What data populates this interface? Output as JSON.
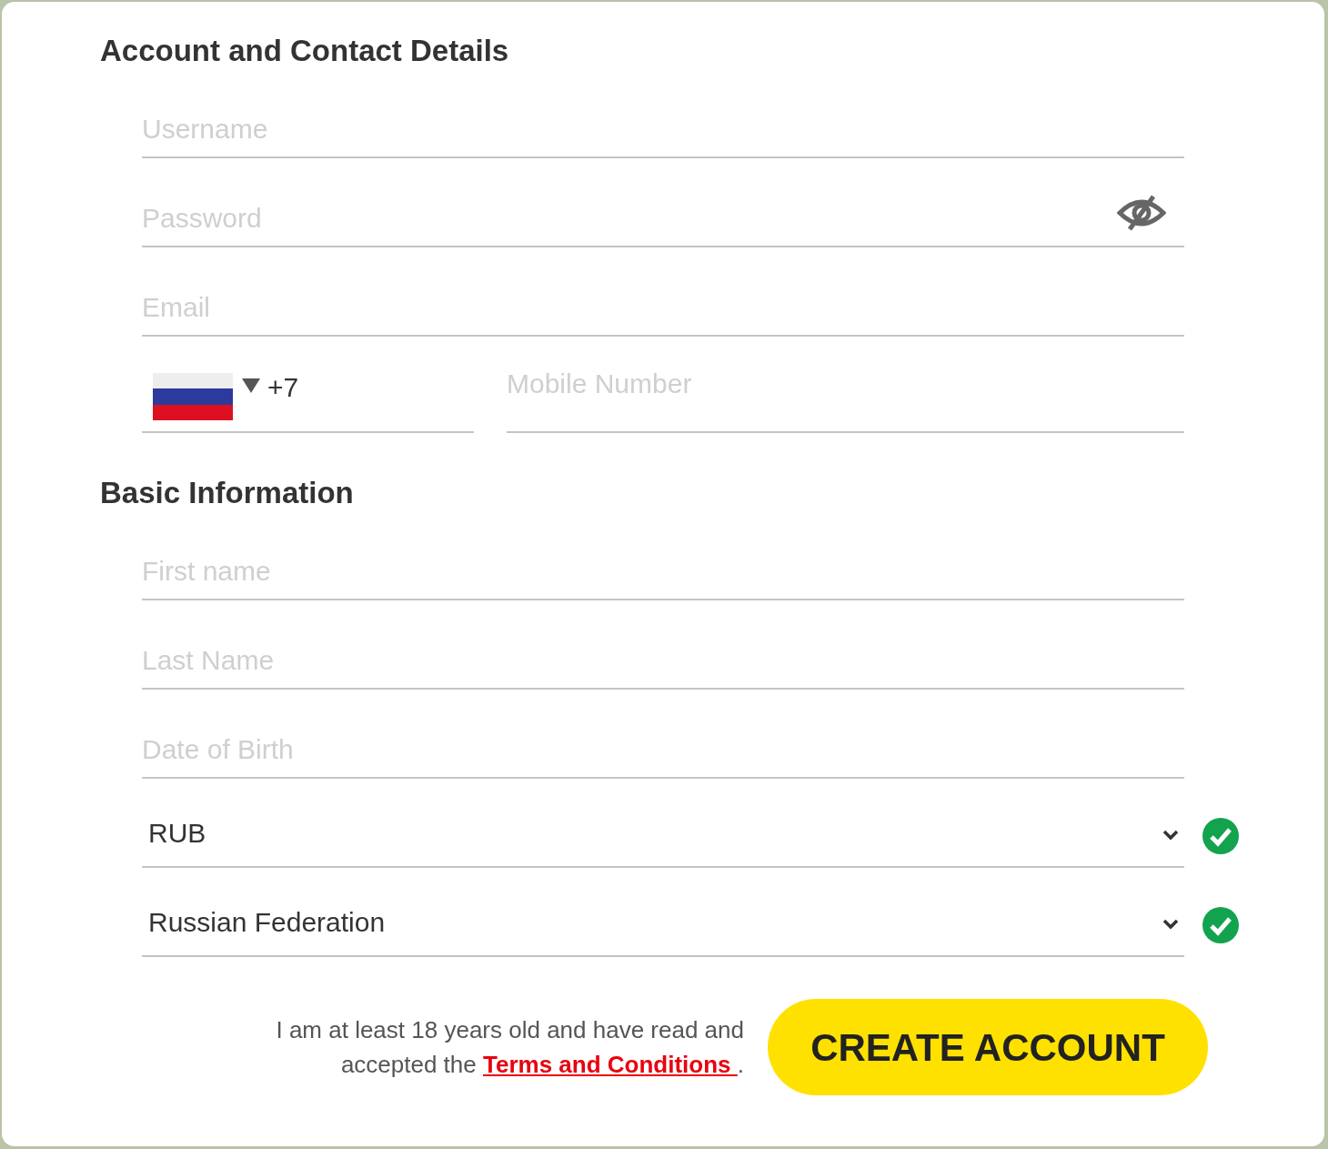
{
  "sections": [
    {
      "title": "Account and Contact Details",
      "fields": [
        {
          "kind": "text",
          "placeholder": "Username"
        },
        {
          "kind": "password",
          "placeholder": "Password",
          "reveal": false
        },
        {
          "kind": "text",
          "placeholder": "Email"
        },
        {
          "kind": "phone",
          "code": "+7",
          "placeholder": "Mobile Number"
        }
      ]
    },
    {
      "title": "Basic Information",
      "fields": [
        {
          "kind": "text",
          "placeholder": "First name"
        },
        {
          "kind": "text",
          "placeholder": "Last Name"
        },
        {
          "kind": "text",
          "placeholder": "Date of Birth"
        },
        {
          "kind": "select",
          "value": "RUB",
          "valid": true
        },
        {
          "kind": "select",
          "value": "Russian Federation",
          "valid": true
        }
      ]
    }
  ],
  "terms": {
    "text": "I am at least 18 years old and have read and accepted the ",
    "link": "Terms and Conditions ",
    "end": "."
  },
  "button": "CREATE ACCOUNT"
}
